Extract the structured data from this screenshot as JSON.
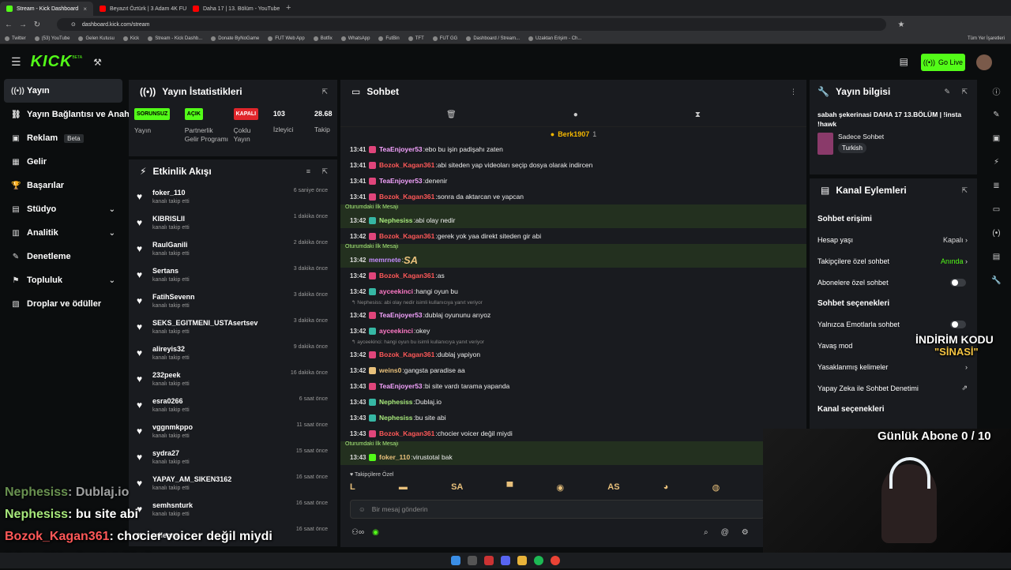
{
  "browser": {
    "tabs": [
      {
        "title": "Stream - Kick Dashboard",
        "color": "#53fc18",
        "active": true
      },
      {
        "title": "Beyazıt Öztürk | 3 Adam 4K FU...",
        "color": "#ff0000",
        "active": false
      },
      {
        "title": "Daha 17 | 13. Bölüm - YouTube",
        "color": "#ff0000",
        "active": false
      }
    ],
    "url": "dashboard.kick.com/stream",
    "bookmarks": [
      "Twitter",
      "(53) YouTube",
      "Gelen Kutusu",
      "Kick",
      "Stream - Kick Dashb...",
      "Donate ByNoGame",
      "FUT Web App",
      "Botfix",
      "WhatsApp",
      "FutBin",
      "TFT",
      "FUT GG",
      "Dashboard / Stream...",
      "Uzaktan Erişim - Ch..."
    ],
    "all_bookmarks": "Tüm Yer İşaretleri"
  },
  "header": {
    "logo": "KICK",
    "beta": "BETA",
    "go_live": "Go Live"
  },
  "sidebar": {
    "items": [
      {
        "label": "Yayın",
        "icon": "((•))",
        "active": true,
        "chevron": false
      },
      {
        "label": "Yayın Bağlantısı ve Anahtarı",
        "icon": "⛓",
        "active": false,
        "chevron": false
      },
      {
        "label": "Reklam",
        "icon": "▣",
        "active": false,
        "chevron": false,
        "badge": "Beta"
      },
      {
        "label": "Gelir",
        "icon": "▦",
        "active": false,
        "chevron": false
      },
      {
        "label": "Başarılar",
        "icon": "🏆",
        "active": false,
        "chevron": false
      },
      {
        "label": "Stüdyo",
        "icon": "▤",
        "active": false,
        "chevron": true
      },
      {
        "label": "Analitik",
        "icon": "▥",
        "active": false,
        "chevron": true
      },
      {
        "label": "Denetleme",
        "icon": "✎",
        "active": false,
        "chevron": false
      },
      {
        "label": "Topluluk",
        "icon": "⚑",
        "active": false,
        "chevron": true
      },
      {
        "label": "Droplar ve ödüller",
        "icon": "▧",
        "active": false,
        "chevron": false
      }
    ]
  },
  "stats": {
    "title": "Yayın İstatistikleri",
    "cards": [
      {
        "badge": "SORUNSUZ",
        "badge_color": "#53fc18",
        "label": "Yayın"
      },
      {
        "badge": "AÇIK",
        "badge_color": "#53fc18",
        "label": "Partnerlik Gelir Programı"
      },
      {
        "badge": "KAPALI",
        "badge_color": "#e0262b",
        "label": "Çoklu Yayın"
      },
      {
        "badge": "103",
        "badge_color": "",
        "label": "İzleyici"
      },
      {
        "badge": "28.68",
        "badge_color": "",
        "label": "Takip"
      }
    ]
  },
  "activity": {
    "title": "Etkinlik Akışı",
    "items": [
      {
        "name": "foker_110",
        "sub": "kanalı takip etti",
        "time": "6 saniye önce"
      },
      {
        "name": "KIBRISLII",
        "sub": "kanalı takip etti",
        "time": "1 dakika önce"
      },
      {
        "name": "RaulGanili",
        "sub": "kanalı takip etti",
        "time": "2 dakika önce"
      },
      {
        "name": "Sertans",
        "sub": "kanalı takip etti",
        "time": "3 dakika önce"
      },
      {
        "name": "FatihSevenn",
        "sub": "kanalı takip etti",
        "time": "3 dakika önce"
      },
      {
        "name": "SEKS_EGITMENI_USTAsertsev",
        "sub": "kanalı takip etti",
        "time": "3 dakika önce"
      },
      {
        "name": "alireyis32",
        "sub": "kanalı takip etti",
        "time": "9 dakika önce"
      },
      {
        "name": "232peek",
        "sub": "kanalı takip etti",
        "time": "16 dakika önce"
      },
      {
        "name": "esra0266",
        "sub": "kanalı takip etti",
        "time": "6 saat önce"
      },
      {
        "name": "vggnmkppo",
        "sub": "kanalı takip etti",
        "time": "11 saat önce"
      },
      {
        "name": "sydra27",
        "sub": "kanalı takip etti",
        "time": "15 saat önce"
      },
      {
        "name": "YAPAY_AM_SIKEN3162",
        "sub": "kanalı takip etti",
        "time": "16 saat önce"
      },
      {
        "name": "semhsnturk",
        "sub": "kanalı takip etti",
        "time": "16 saat önce"
      },
      {
        "name": "mileora",
        "sub": "",
        "time": "16 saat önce"
      }
    ]
  },
  "chat": {
    "title": "Sohbet",
    "pinned_user": "Berk1907",
    "pinned_count": "1",
    "first_msg_label": "Oturumdaki İlk Mesajı",
    "messages": [
      {
        "kind": "msg",
        "time": "13:41",
        "user": "TeaEnjoyer53",
        "color": "#f5a3ff",
        "badge": "#e0457b",
        "text": "ebo bu işin padişahı zaten"
      },
      {
        "kind": "msg",
        "time": "13:41",
        "user": "Bozok_Kagan361",
        "color": "#ff5858",
        "badge": "#e0457b",
        "text": "abi siteden yap videoları seçip dosya olarak indircen"
      },
      {
        "kind": "msg",
        "time": "13:41",
        "user": "TeaEnjoyer53",
        "color": "#f5a3ff",
        "badge": "#e0457b",
        "text": "denenir"
      },
      {
        "kind": "msg",
        "time": "13:41",
        "user": "Bozok_Kagan361",
        "color": "#ff5858",
        "badge": "#e0457b",
        "text": "sonra da aktarcan ve yapcan"
      },
      {
        "kind": "first",
        "text": "Oturumdaki İlk Mesajı"
      },
      {
        "kind": "msg",
        "time": "13:42",
        "user": "Nephesiss",
        "color": "#a7e87b",
        "badge": "#36b7a4",
        "text": "abi olay nedir",
        "hl": true
      },
      {
        "kind": "msg",
        "time": "13:42",
        "user": "Bozok_Kagan361",
        "color": "#ff5858",
        "badge": "#e0457b",
        "text": "gerek yok yaa direkt siteden gir abi"
      },
      {
        "kind": "first",
        "text": "Oturumdaki İlk Mesajı"
      },
      {
        "kind": "msg",
        "time": "13:42",
        "user": "memrnete",
        "color": "#c58cff",
        "badge": "",
        "text": "SA",
        "hl": true
      },
      {
        "kind": "msg",
        "time": "13:42",
        "user": "Bozok_Kagan361",
        "color": "#ff5858",
        "badge": "#e0457b",
        "text": "as"
      },
      {
        "kind": "msg",
        "time": "13:42",
        "user": "ayceekinci",
        "color": "#ff79c6",
        "badge": "#36b7a4",
        "text": "hangi oyun bu"
      },
      {
        "kind": "reply",
        "text": "↰ Nephesiss: abi olay nedir isimli kullanıcıya yanıt veriyor"
      },
      {
        "kind": "msg",
        "time": "13:42",
        "user": "TeaEnjoyer53",
        "color": "#f5a3ff",
        "badge": "#e0457b",
        "text": "dublaj oyununu arıyoz"
      },
      {
        "kind": "msg",
        "time": "13:42",
        "user": "ayceekinci",
        "color": "#ff79c6",
        "badge": "#36b7a4",
        "text": "okey"
      },
      {
        "kind": "reply",
        "text": "↰ ayceekinci: hangi oyun bu isimli kullanıcıya yanıt veriyor"
      },
      {
        "kind": "msg",
        "time": "13:42",
        "user": "Bozok_Kagan361",
        "color": "#ff5858",
        "badge": "#e0457b",
        "text": "dublaj yapiyon"
      },
      {
        "kind": "msg",
        "time": "13:42",
        "user": "weins0",
        "color": "#e8c07b",
        "badge": "#e8c07b",
        "text": "gangsta paradise aa"
      },
      {
        "kind": "msg",
        "time": "13:43",
        "user": "TeaEnjoyer53",
        "color": "#f5a3ff",
        "badge": "#e0457b",
        "text": "bi site vardı tarama yapanda"
      },
      {
        "kind": "msg",
        "time": "13:43",
        "user": "Nephesiss",
        "color": "#a7e87b",
        "badge": "#36b7a4",
        "text": "Dublaj.io"
      },
      {
        "kind": "msg",
        "time": "13:43",
        "user": "Nephesiss",
        "color": "#a7e87b",
        "badge": "#36b7a4",
        "text": "bu site abi"
      },
      {
        "kind": "msg",
        "time": "13:43",
        "user": "Bozok_Kagan361",
        "color": "#ff5858",
        "badge": "#e0457b",
        "text": "chocier voicer değil miydi"
      },
      {
        "kind": "first",
        "text": "Oturumdaki İlk Mesajı"
      },
      {
        "kind": "msg",
        "time": "13:43",
        "user": "foker_110",
        "color": "#e8c07b",
        "badge": "#53fc18",
        "text": "virustotal bak",
        "hl": true
      }
    ],
    "followers_only": "Takipçilere Özel",
    "emotes": [
      "L",
      "▬",
      "SA",
      "▀",
      "◉",
      "AS",
      "◕",
      "◍",
      "◙"
    ],
    "input_placeholder": "Bir mesaj gönderin"
  },
  "stream_info": {
    "title": "Yayın bilgisi",
    "stream_title": "sabah şekerinasi DAHA 17 13.BÖLÜM | !insta !hawk",
    "category": "Sadece Sohbet",
    "language": "Turkish"
  },
  "channel_actions": {
    "title": "Kanal Eylemleri",
    "chat_access": "Sohbet erişimi",
    "account_age": "Hesap yaşı",
    "account_age_val": "Kapalı",
    "followers_only": "Takipçilere özel sohbet",
    "followers_only_val": "Anında",
    "subs_only": "Abonelere özel sohbet",
    "chat_options": "Sohbet seçenekleri",
    "emote_only": "Yalnızca Emotlarla sohbet",
    "slow_mode": "Yavaş mod",
    "banned_words": "Yasaklanmış kelimeler",
    "ai_moderation": "Yapay Zeka ile Sohbet Denetimi",
    "channel_options": "Kanal seçenekleri"
  },
  "overlay": {
    "lines": [
      {
        "user": "Nephesiss",
        "color": "#a7e87b",
        "text": ": Dublaj.io"
      },
      {
        "user": "Nephesiss",
        "color": "#a7e87b",
        "text": ": bu site abi"
      },
      {
        "user": "Bozok_Kagan361",
        "color": "#ff5858",
        "text": ": chocier voicer değil miydi"
      },
      {
        "user": "foker_110",
        "color": "#e8c07b",
        "text": ": virustotal bak"
      }
    ],
    "sub_goal": "Günlük Abone 0 / 10",
    "promo_line1": "İNDİRİM KODU",
    "promo_line2": "\"SİNASİ\""
  }
}
